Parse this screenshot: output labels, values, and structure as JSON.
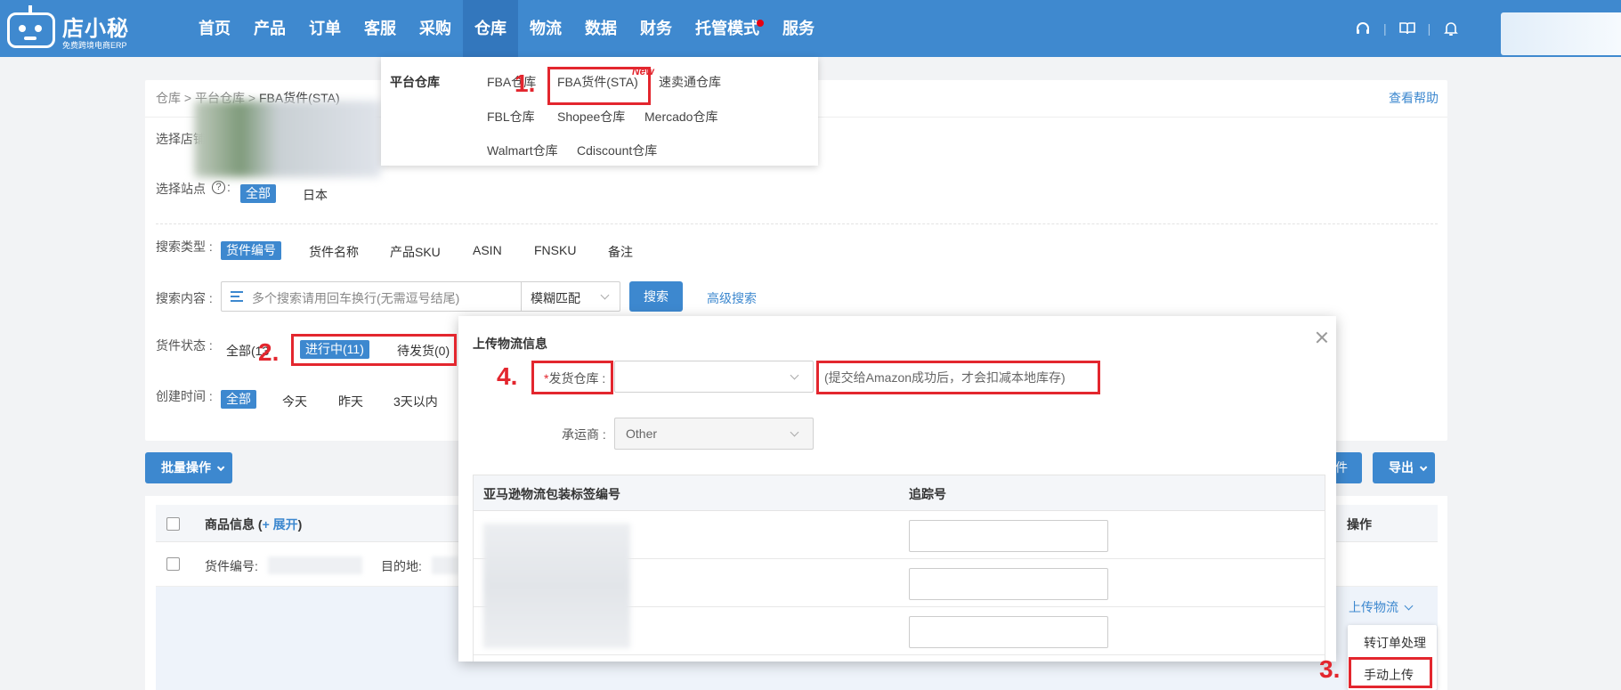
{
  "header": {
    "logo_name": "店小秘",
    "logo_sub": "免费跨境电商ERP",
    "nav": [
      "首页",
      "产品",
      "订单",
      "客服",
      "采购",
      "仓库",
      "物流",
      "数据",
      "财务",
      "托管模式",
      "服务"
    ],
    "active_nav": "仓库",
    "icons": [
      "headset-icon",
      "book-icon",
      "bell-icon"
    ]
  },
  "dropdown": {
    "category": "平台仓库",
    "links": [
      "FBA仓库",
      "FBA货件(STA)",
      "速卖通仓库",
      "FBL仓库",
      "Shopee仓库",
      "Mercado仓库",
      "Walmart仓库",
      "Cdiscount仓库"
    ],
    "new_badge": "New"
  },
  "breadcrumb": {
    "a": "仓库",
    "b": "平台仓库",
    "current": "FBA货件(STA)"
  },
  "help_link": "查看帮助",
  "filters": {
    "shop_label": "选择店铺 :",
    "shop_all": "全部",
    "site_label": "选择站点",
    "site_all": "全部",
    "site_option": "日本",
    "search_type_label": "搜索类型 :",
    "search_types": [
      "货件编号",
      "货件名称",
      "产品SKU",
      "ASIN",
      "FNSKU",
      "备注"
    ],
    "search_content_label": "搜索内容 :",
    "search_placeholder": "多个搜索请用回车换行(无需逗号结尾)",
    "match_mode": "模糊匹配",
    "search_button": "搜索",
    "advanced_search": "高级搜索",
    "status_label": "货件状态 :",
    "status_all": "全部(13",
    "status_in_progress": "进行中(11)",
    "status_pending": "待发货(0)",
    "created_label": "创建时间 :",
    "created_options": [
      "全部",
      "今天",
      "昨天",
      "3天以内"
    ]
  },
  "toolbar": {
    "batch": "批量操作",
    "partial": "件",
    "export": "导出"
  },
  "table": {
    "col_product": "商品信息 (",
    "expand": "+ 展开",
    "expand_close": ")",
    "col_op": "操作",
    "shipment_no_label": "货件编号:",
    "destination_label": "目的地:",
    "upload_logistics": "上传物流"
  },
  "popmenu": {
    "to_order": "转订单处理",
    "manual_upload": "手动上传"
  },
  "modal": {
    "title": "上传物流信息",
    "warehouse_required_mark": "*",
    "warehouse_label": "发货仓库 :",
    "warehouse_hint": "(提交给Amazon成功后，才会扣减本地库存)",
    "carrier_label": "承运商 :",
    "carrier_value": "Other",
    "col_label_no": "亚马逊物流包装标签编号",
    "col_tracking": "追踪号"
  },
  "annotations": [
    "1.",
    "2.",
    "3.",
    "4."
  ],
  "colors": {
    "brand": "#3f89cf",
    "accent": "#3d88cf",
    "annotation": "#e3262e"
  }
}
